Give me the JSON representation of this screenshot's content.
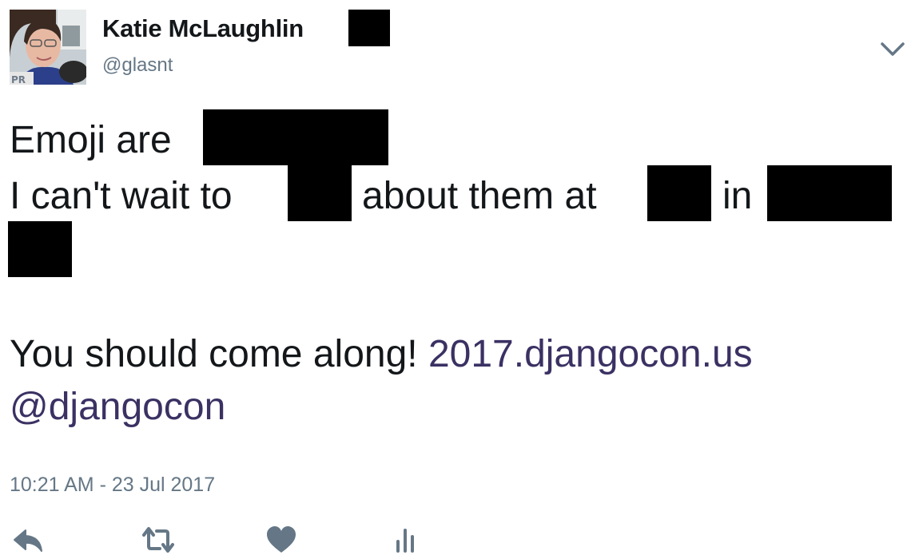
{
  "author": {
    "name": "Katie McLaughlin",
    "handle": "@glasnt"
  },
  "tweet": {
    "line1_text": "Emoji are",
    "line2_part1": "I can't wait to",
    "line2_part2": "about them at",
    "line2_part3": "in",
    "line4_text": "You should come along!",
    "link_url": "2017.djangocon.us",
    "mention": "@djangocon"
  },
  "timestamp": "10:21 AM - 23 Jul 2017",
  "icons": {
    "menu": "chevron-down-icon",
    "reply": "reply-icon",
    "retweet": "retweet-icon",
    "like": "heart-icon",
    "stats": "analytics-icon"
  },
  "colors": {
    "link": "#3b3163",
    "secondary_text": "#657786",
    "icon": "#657786",
    "redaction": "#000000"
  }
}
